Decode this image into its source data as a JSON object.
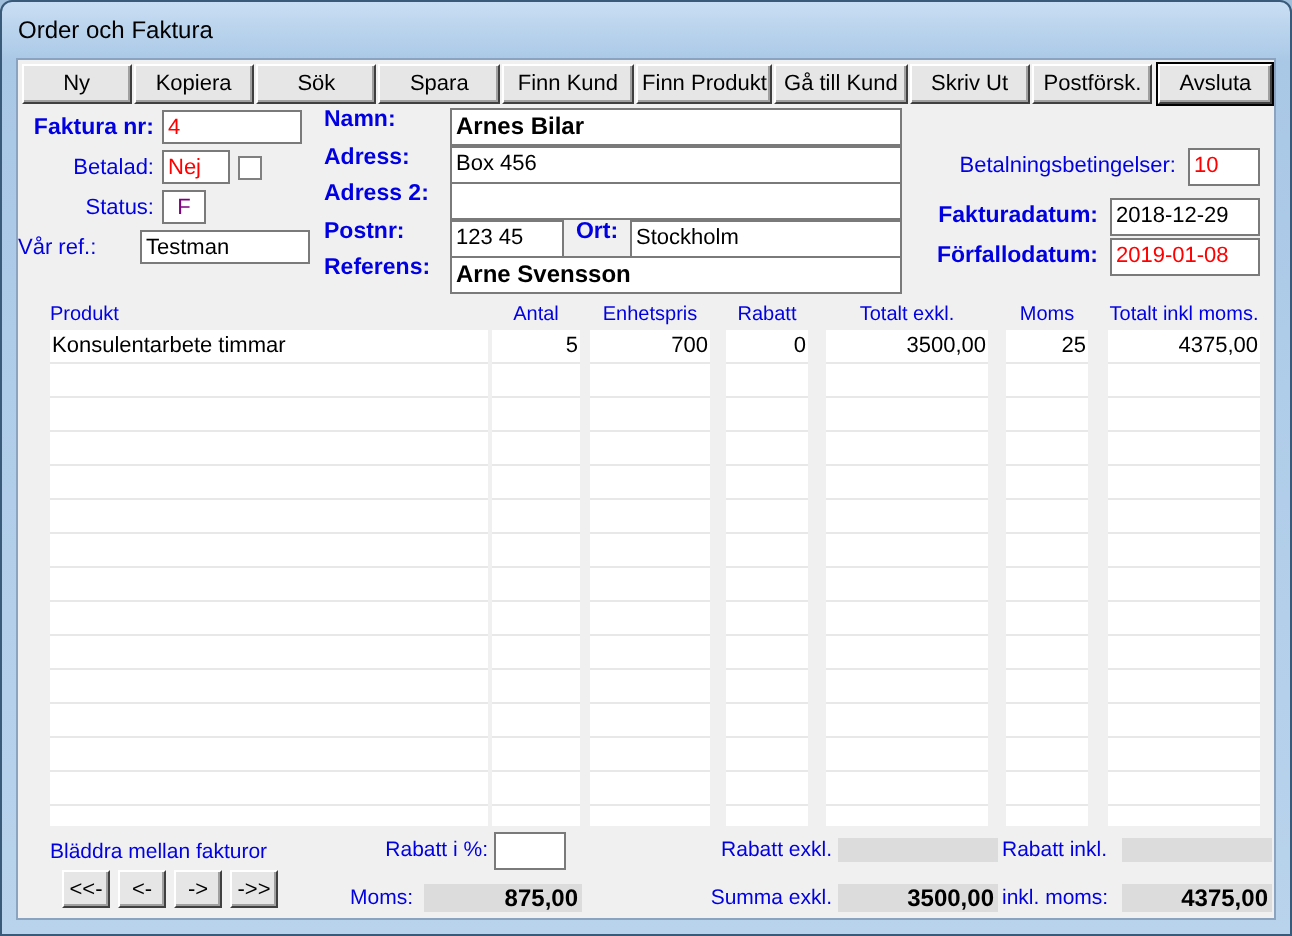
{
  "window": {
    "title": "Order och Faktura"
  },
  "toolbar": [
    {
      "label": "Ny",
      "default": false
    },
    {
      "label": "Kopiera",
      "default": false
    },
    {
      "label": "Sök",
      "default": false
    },
    {
      "label": "Spara",
      "default": false
    },
    {
      "label": "Finn Kund",
      "default": false
    },
    {
      "label": "Finn Produkt",
      "default": false
    },
    {
      "label": "Gå till Kund",
      "default": false
    },
    {
      "label": "Skriv Ut",
      "default": false
    },
    {
      "label": "Postförsk.",
      "default": false
    },
    {
      "label": "Avsluta",
      "default": true
    }
  ],
  "invoice": {
    "number_label": "Faktura nr:",
    "number": "4",
    "paid_label": "Betalad:",
    "paid": "Nej",
    "paid_checked": false,
    "status_label": "Status:",
    "status": "F",
    "ref_label": "Vår ref.:",
    "ref": "Testman"
  },
  "customer": {
    "name_label": "Namn:",
    "name": "Arnes Bilar",
    "address_label": "Adress:",
    "address": "Box 456",
    "address2_label": "Adress 2:",
    "postcode_label": "Postnr:",
    "postcode": "123 45",
    "city_label": "Ort:",
    "city": "Stockholm",
    "reference_label": "Referens:",
    "reference": "Arne Svensson"
  },
  "terms": {
    "label": "Betalningsbetingelser:",
    "value": "10"
  },
  "invoice_date": {
    "label": "Fakturadatum:",
    "value": "2018-12-29"
  },
  "due_date": {
    "label": "Förfallodatum:",
    "value": "2019-01-08"
  },
  "table": {
    "columns": [
      "Produkt",
      "Antal",
      "Enhetspris",
      "Rabatt",
      "Totalt exkl.",
      "Moms",
      "Totalt inkl moms."
    ],
    "rows": [
      [
        "Konsulentarbete timmar",
        "5",
        "700",
        "0",
        "3500,00",
        "25",
        "4375,00"
      ]
    ]
  },
  "footer": {
    "browse_label": "Bläddra mellan fakturor",
    "browse_buttons": [
      "<<-",
      "<-",
      "->",
      "->>"
    ],
    "discount_pct_label": "Rabatt i %:",
    "vat_label": "Moms:",
    "vat": "875,00",
    "discount_excl_label": "Rabatt exkl.",
    "discount_incl_label": "Rabatt inkl.",
    "sum_excl_label": "Summa exkl.",
    "sum_excl": "3500,00",
    "incl_vat_label": "inkl. moms:",
    "incl_vat": "4375,00"
  }
}
